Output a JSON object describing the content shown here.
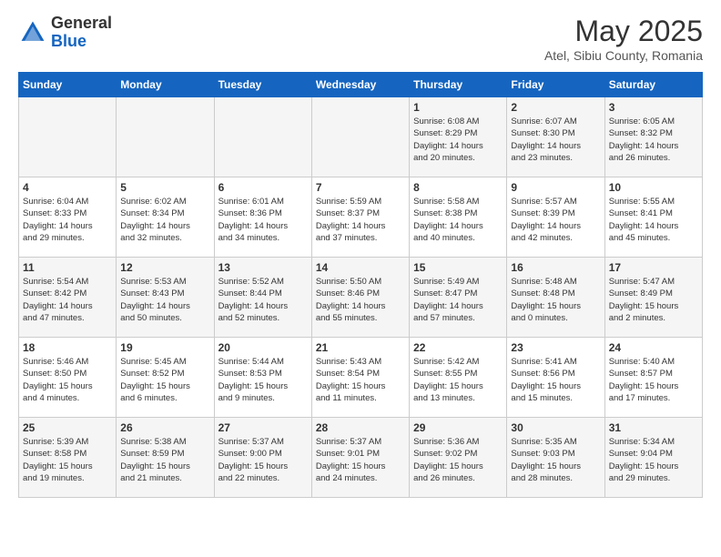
{
  "header": {
    "logo_general": "General",
    "logo_blue": "Blue",
    "month_title": "May 2025",
    "location": "Atel, Sibiu County, Romania"
  },
  "weekdays": [
    "Sunday",
    "Monday",
    "Tuesday",
    "Wednesday",
    "Thursday",
    "Friday",
    "Saturday"
  ],
  "weeks": [
    [
      {
        "day": "",
        "info": ""
      },
      {
        "day": "",
        "info": ""
      },
      {
        "day": "",
        "info": ""
      },
      {
        "day": "",
        "info": ""
      },
      {
        "day": "1",
        "info": "Sunrise: 6:08 AM\nSunset: 8:29 PM\nDaylight: 14 hours\nand 20 minutes."
      },
      {
        "day": "2",
        "info": "Sunrise: 6:07 AM\nSunset: 8:30 PM\nDaylight: 14 hours\nand 23 minutes."
      },
      {
        "day": "3",
        "info": "Sunrise: 6:05 AM\nSunset: 8:32 PM\nDaylight: 14 hours\nand 26 minutes."
      }
    ],
    [
      {
        "day": "4",
        "info": "Sunrise: 6:04 AM\nSunset: 8:33 PM\nDaylight: 14 hours\nand 29 minutes."
      },
      {
        "day": "5",
        "info": "Sunrise: 6:02 AM\nSunset: 8:34 PM\nDaylight: 14 hours\nand 32 minutes."
      },
      {
        "day": "6",
        "info": "Sunrise: 6:01 AM\nSunset: 8:36 PM\nDaylight: 14 hours\nand 34 minutes."
      },
      {
        "day": "7",
        "info": "Sunrise: 5:59 AM\nSunset: 8:37 PM\nDaylight: 14 hours\nand 37 minutes."
      },
      {
        "day": "8",
        "info": "Sunrise: 5:58 AM\nSunset: 8:38 PM\nDaylight: 14 hours\nand 40 minutes."
      },
      {
        "day": "9",
        "info": "Sunrise: 5:57 AM\nSunset: 8:39 PM\nDaylight: 14 hours\nand 42 minutes."
      },
      {
        "day": "10",
        "info": "Sunrise: 5:55 AM\nSunset: 8:41 PM\nDaylight: 14 hours\nand 45 minutes."
      }
    ],
    [
      {
        "day": "11",
        "info": "Sunrise: 5:54 AM\nSunset: 8:42 PM\nDaylight: 14 hours\nand 47 minutes."
      },
      {
        "day": "12",
        "info": "Sunrise: 5:53 AM\nSunset: 8:43 PM\nDaylight: 14 hours\nand 50 minutes."
      },
      {
        "day": "13",
        "info": "Sunrise: 5:52 AM\nSunset: 8:44 PM\nDaylight: 14 hours\nand 52 minutes."
      },
      {
        "day": "14",
        "info": "Sunrise: 5:50 AM\nSunset: 8:46 PM\nDaylight: 14 hours\nand 55 minutes."
      },
      {
        "day": "15",
        "info": "Sunrise: 5:49 AM\nSunset: 8:47 PM\nDaylight: 14 hours\nand 57 minutes."
      },
      {
        "day": "16",
        "info": "Sunrise: 5:48 AM\nSunset: 8:48 PM\nDaylight: 15 hours\nand 0 minutes."
      },
      {
        "day": "17",
        "info": "Sunrise: 5:47 AM\nSunset: 8:49 PM\nDaylight: 15 hours\nand 2 minutes."
      }
    ],
    [
      {
        "day": "18",
        "info": "Sunrise: 5:46 AM\nSunset: 8:50 PM\nDaylight: 15 hours\nand 4 minutes."
      },
      {
        "day": "19",
        "info": "Sunrise: 5:45 AM\nSunset: 8:52 PM\nDaylight: 15 hours\nand 6 minutes."
      },
      {
        "day": "20",
        "info": "Sunrise: 5:44 AM\nSunset: 8:53 PM\nDaylight: 15 hours\nand 9 minutes."
      },
      {
        "day": "21",
        "info": "Sunrise: 5:43 AM\nSunset: 8:54 PM\nDaylight: 15 hours\nand 11 minutes."
      },
      {
        "day": "22",
        "info": "Sunrise: 5:42 AM\nSunset: 8:55 PM\nDaylight: 15 hours\nand 13 minutes."
      },
      {
        "day": "23",
        "info": "Sunrise: 5:41 AM\nSunset: 8:56 PM\nDaylight: 15 hours\nand 15 minutes."
      },
      {
        "day": "24",
        "info": "Sunrise: 5:40 AM\nSunset: 8:57 PM\nDaylight: 15 hours\nand 17 minutes."
      }
    ],
    [
      {
        "day": "25",
        "info": "Sunrise: 5:39 AM\nSunset: 8:58 PM\nDaylight: 15 hours\nand 19 minutes."
      },
      {
        "day": "26",
        "info": "Sunrise: 5:38 AM\nSunset: 8:59 PM\nDaylight: 15 hours\nand 21 minutes."
      },
      {
        "day": "27",
        "info": "Sunrise: 5:37 AM\nSunset: 9:00 PM\nDaylight: 15 hours\nand 22 minutes."
      },
      {
        "day": "28",
        "info": "Sunrise: 5:37 AM\nSunset: 9:01 PM\nDaylight: 15 hours\nand 24 minutes."
      },
      {
        "day": "29",
        "info": "Sunrise: 5:36 AM\nSunset: 9:02 PM\nDaylight: 15 hours\nand 26 minutes."
      },
      {
        "day": "30",
        "info": "Sunrise: 5:35 AM\nSunset: 9:03 PM\nDaylight: 15 hours\nand 28 minutes."
      },
      {
        "day": "31",
        "info": "Sunrise: 5:34 AM\nSunset: 9:04 PM\nDaylight: 15 hours\nand 29 minutes."
      }
    ]
  ]
}
